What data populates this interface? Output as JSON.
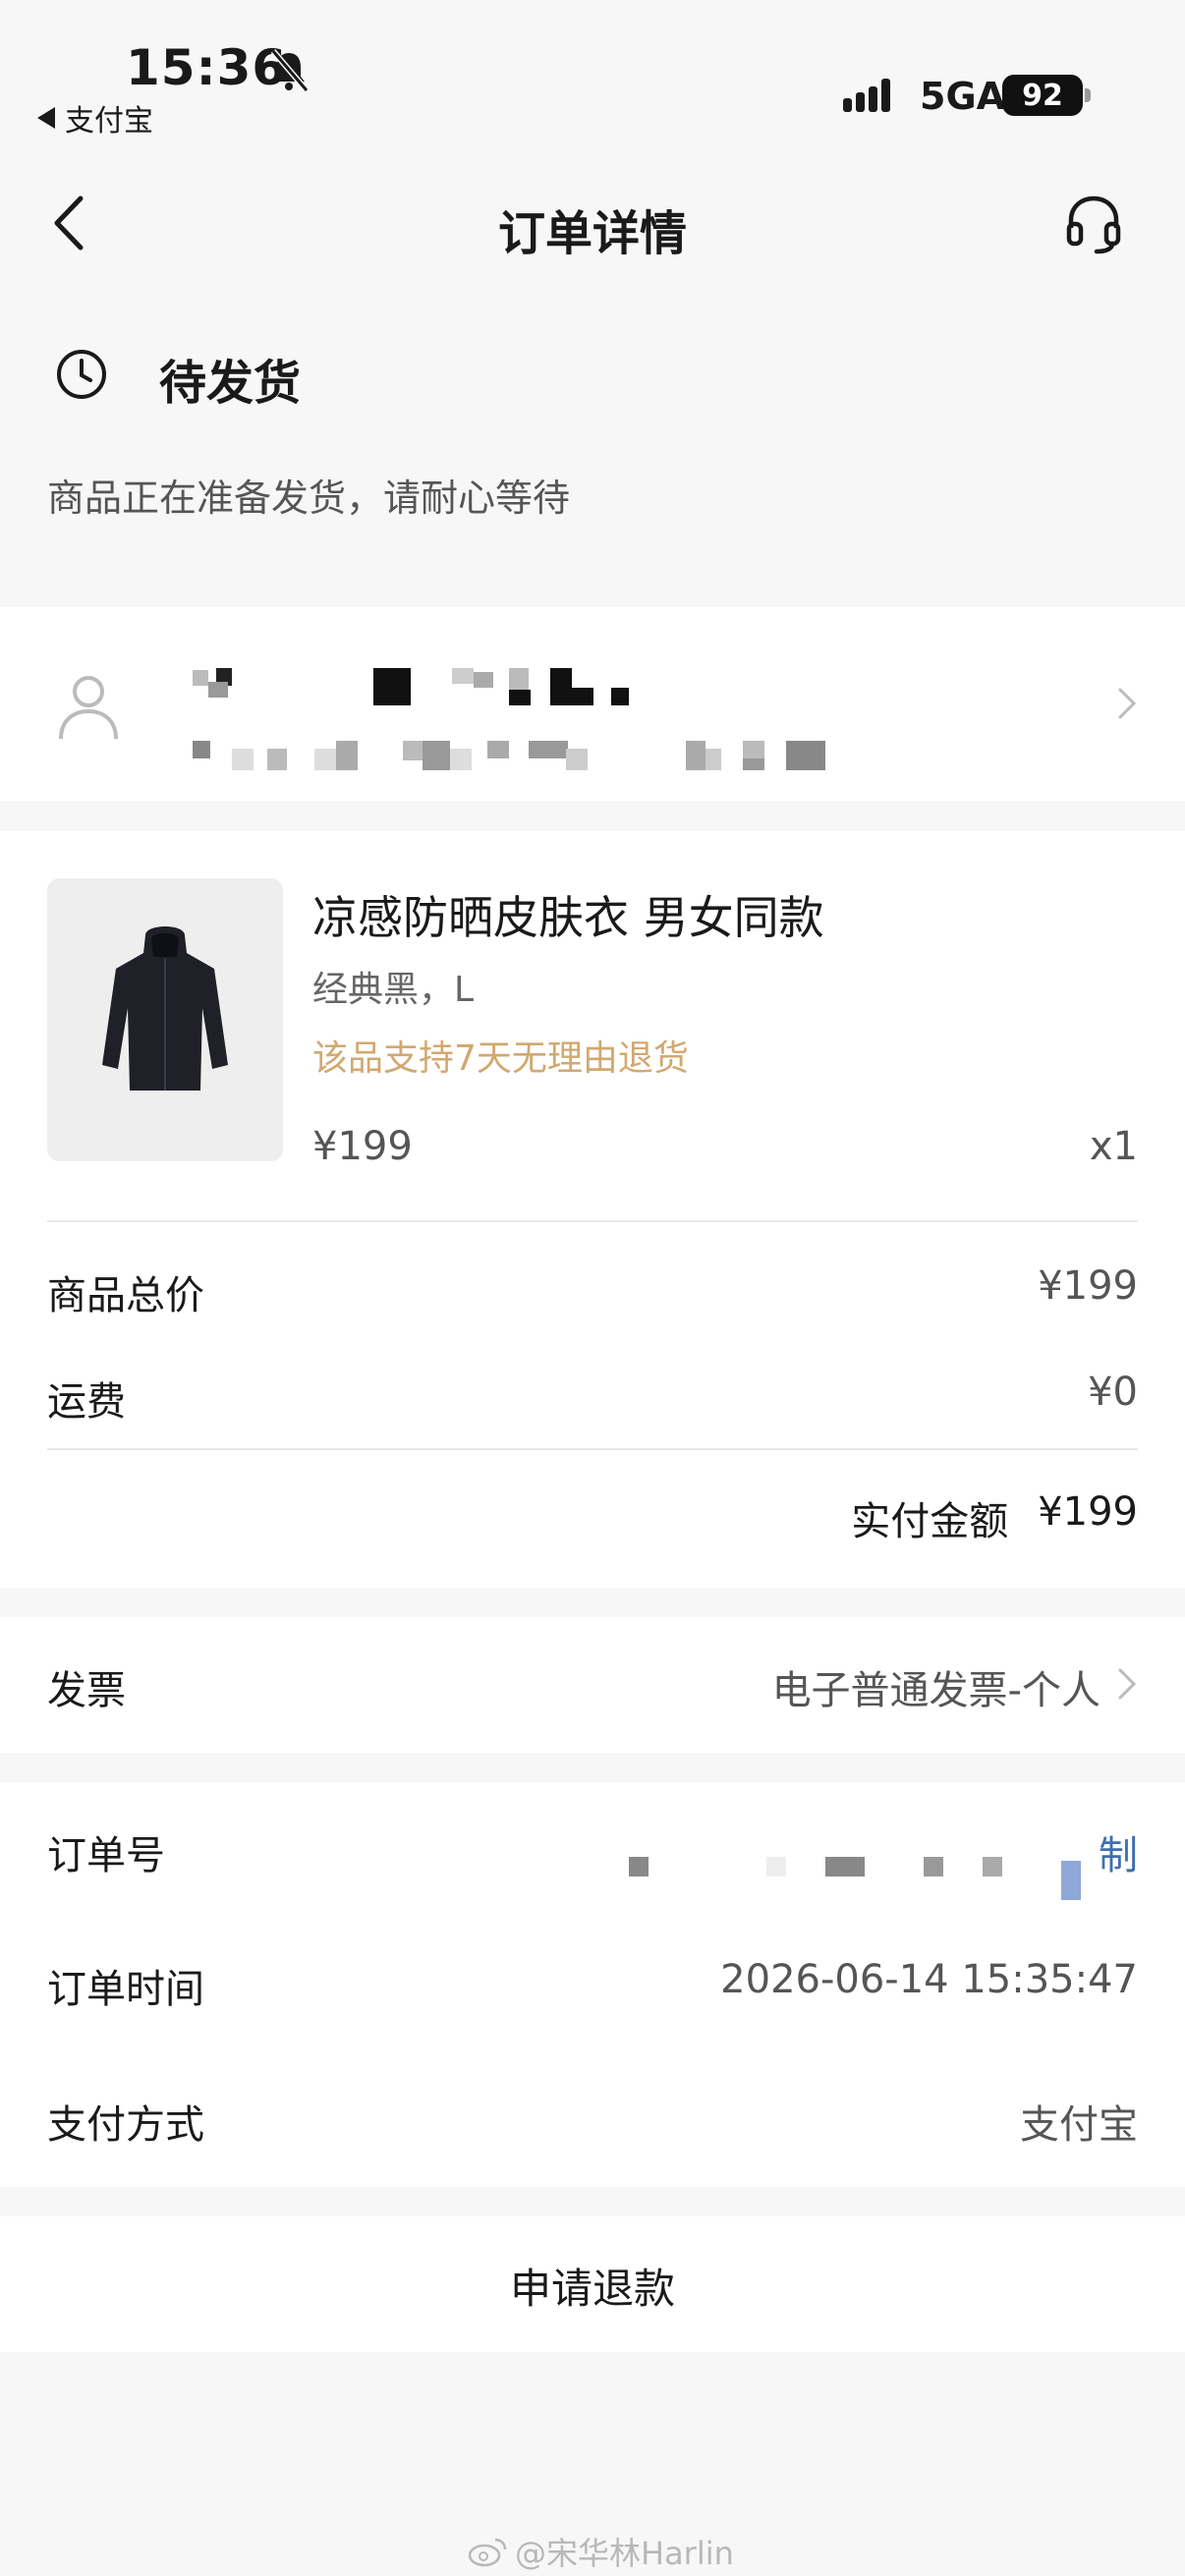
{
  "status_bar": {
    "time": "15:36",
    "back_app": "支付宝",
    "network": "5GA",
    "battery": "92"
  },
  "nav": {
    "title": "订单详情"
  },
  "order_status": {
    "title": "待发货",
    "description": "商品正在准备发货，请耐心等待"
  },
  "product": {
    "name": "凉感防晒皮肤衣 男女同款",
    "spec": "经典黑，L",
    "promise": "该品支持7天无理由退货",
    "price": "¥199",
    "quantity": "x1"
  },
  "price_summary": {
    "subtotal_label": "商品总价",
    "subtotal_value": "¥199",
    "shipping_label": "运费",
    "shipping_value": "¥0",
    "paid_label": "实付金额",
    "paid_value": "¥199"
  },
  "invoice": {
    "label": "发票",
    "value": "电子普通发票-个人"
  },
  "order_info": {
    "order_no_label": "订单号",
    "copy_label": "制",
    "time_label": "订单时间",
    "time_value": "2026-06-14 15:35:47",
    "payment_label": "支付方式",
    "payment_value": "支付宝"
  },
  "actions": {
    "refund_label": "申请退款"
  },
  "watermark": "@宋华林Harlin",
  "colors": {
    "background": "#f7f7f7",
    "card": "#ffffff",
    "promise": "#d2a870",
    "link": "#3f6fb0"
  }
}
